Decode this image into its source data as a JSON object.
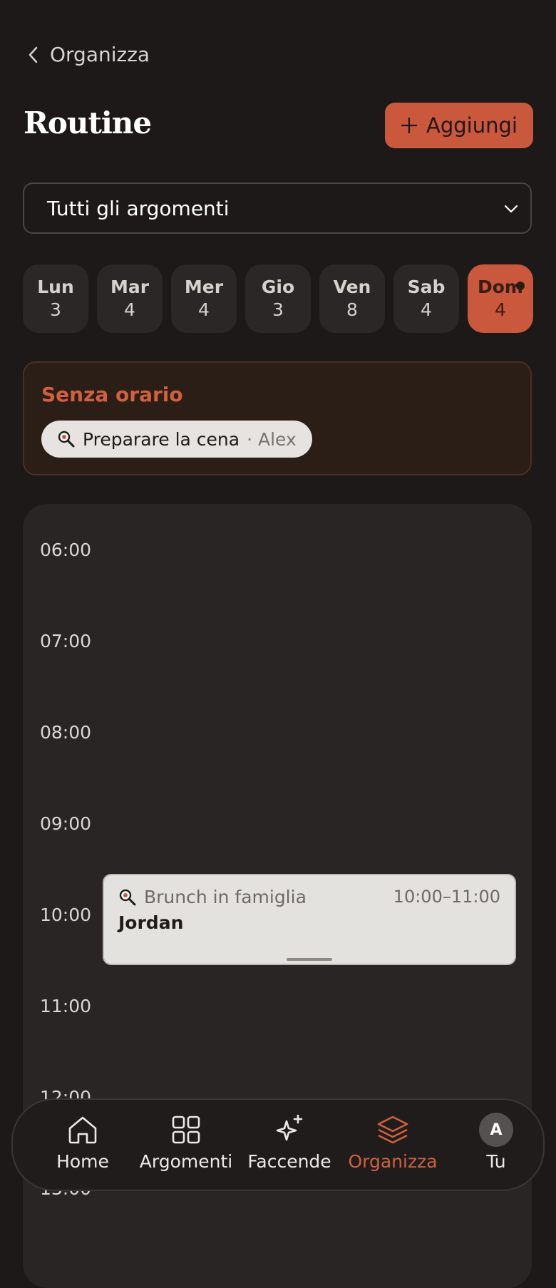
{
  "header": {
    "back_label": "Organizza",
    "title": "Routine",
    "add_label": "Aggiungi"
  },
  "filter": {
    "selected": "Tutti gli argomenti"
  },
  "days": [
    {
      "name": "Lun",
      "count": "3"
    },
    {
      "name": "Mar",
      "count": "4"
    },
    {
      "name": "Mer",
      "count": "4"
    },
    {
      "name": "Gio",
      "count": "3"
    },
    {
      "name": "Ven",
      "count": "8"
    },
    {
      "name": "Sab",
      "count": "4"
    },
    {
      "name": "Dom",
      "count": "4"
    }
  ],
  "untimed": {
    "title": "Senza orario",
    "task": "Preparare la cena",
    "assignee": "· Alex"
  },
  "timeline": {
    "hours": [
      "06:00",
      "07:00",
      "08:00",
      "09:00",
      "10:00",
      "11:00",
      "12:00",
      "13:00"
    ],
    "event": {
      "title": "Brunch in famiglia",
      "time": "10:00–11:00",
      "person": "Jordan"
    }
  },
  "nav": {
    "home": "Home",
    "topics": "Argomenti",
    "chores": "Faccende",
    "organize": "Organizza",
    "you": "Tu",
    "avatar_letter": "A"
  },
  "colors": {
    "accent": "#c9583c",
    "background": "#1c1918",
    "card": "#282524"
  }
}
